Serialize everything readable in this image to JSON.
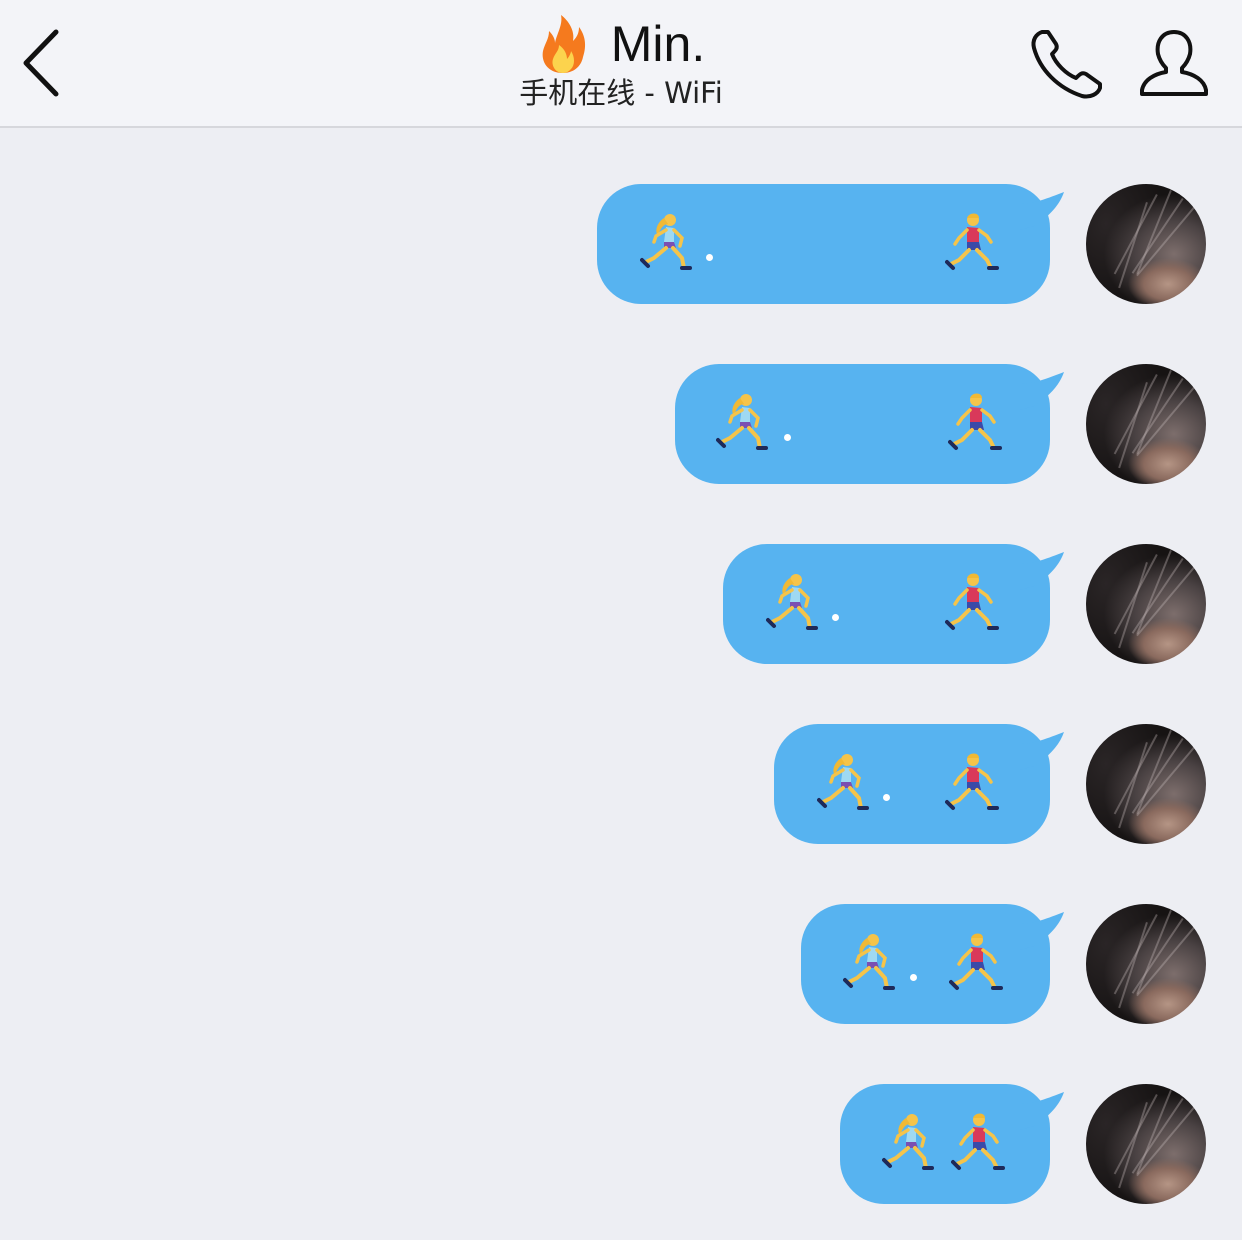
{
  "header": {
    "title": "Min.",
    "subtitle": "手机在线 - WiFi",
    "icons": {
      "back": "chevron-left-icon",
      "title_emoji": "fire-icon",
      "call": "phone-icon",
      "profile": "person-icon"
    }
  },
  "messages": [
    {
      "text": "🏃‍♀️.          🏃‍♂️",
      "female_emoji": "woman-running-icon",
      "male_emoji": "man-running-icon"
    },
    {
      "text": "🏃‍♀️.       🏃‍♂️",
      "female_emoji": "woman-running-icon",
      "male_emoji": "man-running-icon"
    },
    {
      "text": "🏃‍♀️.     🏃‍♂️",
      "female_emoji": "woman-running-icon",
      "male_emoji": "man-running-icon"
    },
    {
      "text": "🏃‍♀️.  🏃‍♂️",
      "female_emoji": "woman-running-icon",
      "male_emoji": "man-running-icon"
    },
    {
      "text": "🏃‍♀️. 🏃‍♂️",
      "female_emoji": "woman-running-icon",
      "male_emoji": "man-running-icon"
    },
    {
      "text": "🏃‍♀️🏃‍♂️",
      "female_emoji": "woman-running-icon",
      "male_emoji": "man-running-icon"
    }
  ],
  "colors": {
    "bubble": "#57b3f0",
    "background": "#edeef3",
    "header": "#f3f4f8"
  }
}
